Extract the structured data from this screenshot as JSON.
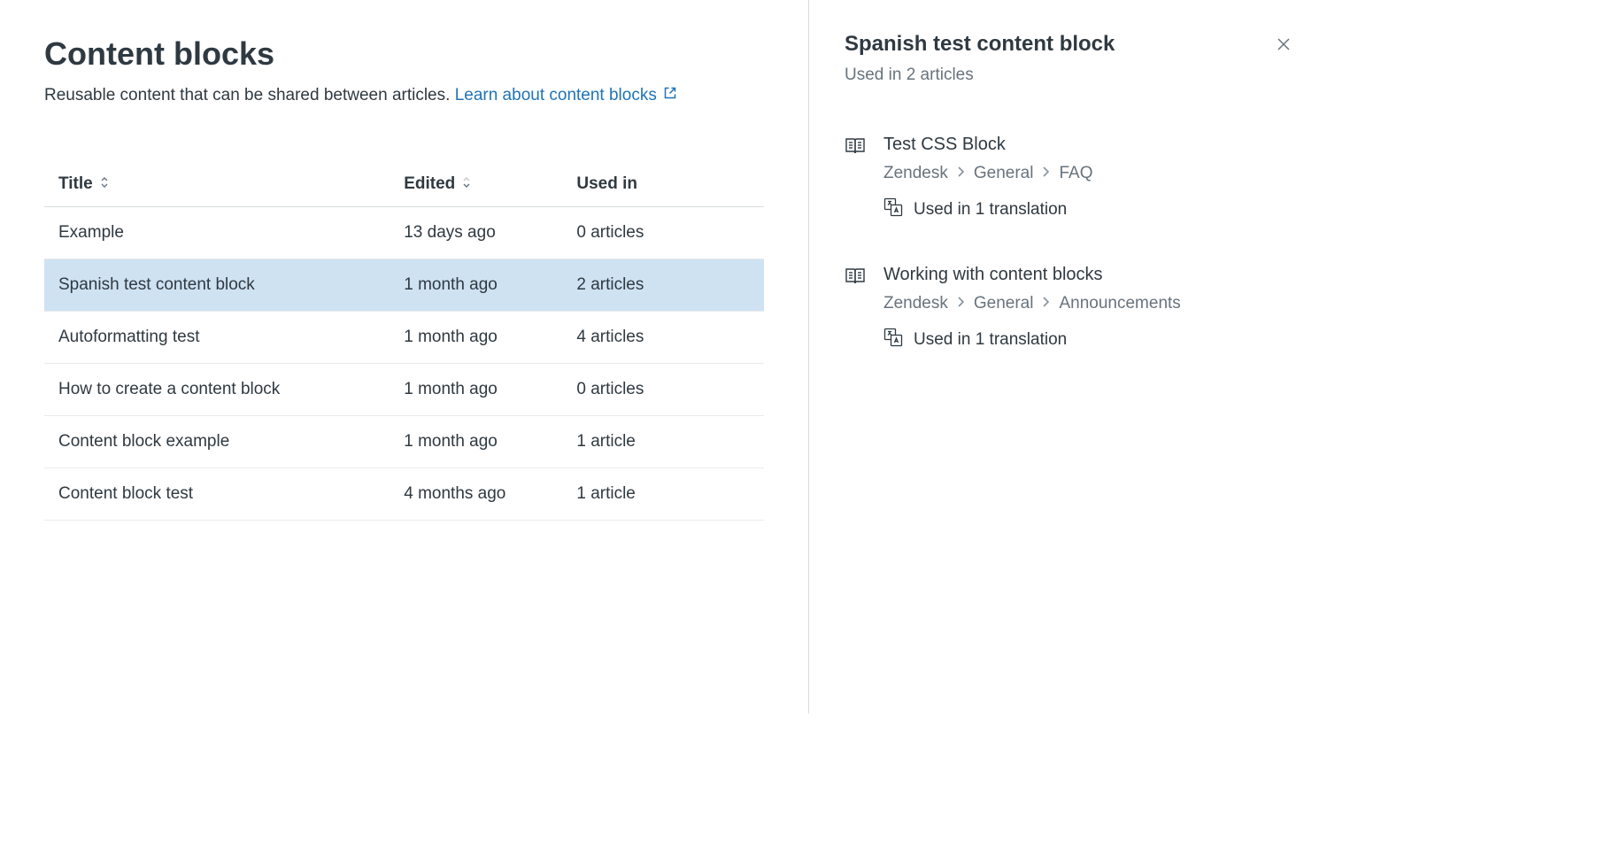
{
  "header": {
    "title": "Content blocks",
    "subtitle_prefix": "Reusable content that can be shared between articles. ",
    "link_text": "Learn about content blocks"
  },
  "table": {
    "columns": {
      "title": "Title",
      "edited": "Edited",
      "used_in": "Used in"
    },
    "rows": [
      {
        "title": "Example",
        "edited": "13 days ago",
        "used_in": "0 articles",
        "selected": false
      },
      {
        "title": "Spanish test content block",
        "edited": "1 month ago",
        "used_in": "2 articles",
        "selected": true
      },
      {
        "title": "Autoformatting test",
        "edited": "1 month ago",
        "used_in": "4 articles",
        "selected": false
      },
      {
        "title": "How to create a content block",
        "edited": "1 month ago",
        "used_in": "0 articles",
        "selected": false
      },
      {
        "title": "Content block example",
        "edited": "1 month ago",
        "used_in": "1 article",
        "selected": false
      },
      {
        "title": "Content block test",
        "edited": "4 months ago",
        "used_in": "1 article",
        "selected": false
      }
    ]
  },
  "side": {
    "title": "Spanish test content block",
    "subtitle": "Used in 2 articles",
    "articles": [
      {
        "title": "Test CSS Block",
        "breadcrumb": [
          "Zendesk",
          "General",
          "FAQ"
        ],
        "translation": "Used in 1 translation"
      },
      {
        "title": "Working with content blocks",
        "breadcrumb": [
          "Zendesk",
          "General",
          "Announcements"
        ],
        "translation": "Used in 1 translation"
      }
    ]
  }
}
